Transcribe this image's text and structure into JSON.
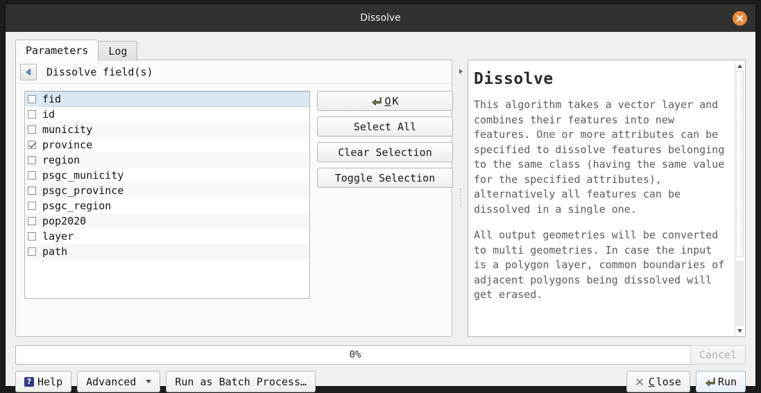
{
  "window": {
    "title": "Dissolve",
    "close_icon": "close-circle-icon"
  },
  "tabs": [
    {
      "label": "Parameters",
      "active": true
    },
    {
      "label": "Log",
      "active": false
    }
  ],
  "group": {
    "collapse_icon": "triangle-left-icon",
    "title": "Dissolve field(s)"
  },
  "field_list": {
    "items": [
      {
        "label": "fid",
        "checked": false,
        "selected": true
      },
      {
        "label": "id",
        "checked": false,
        "selected": false
      },
      {
        "label": "municity",
        "checked": false,
        "selected": false
      },
      {
        "label": "province",
        "checked": true,
        "selected": false
      },
      {
        "label": "region",
        "checked": false,
        "selected": false
      },
      {
        "label": "psgc_municity",
        "checked": false,
        "selected": false
      },
      {
        "label": "psgc_province",
        "checked": false,
        "selected": false
      },
      {
        "label": "psgc_region",
        "checked": false,
        "selected": false
      },
      {
        "label": "pop2020",
        "checked": false,
        "selected": false
      },
      {
        "label": "layer",
        "checked": false,
        "selected": false
      },
      {
        "label": "path",
        "checked": false,
        "selected": false
      }
    ]
  },
  "side_buttons": {
    "ok": {
      "label": "OK",
      "accel": "O",
      "icon": "green-enter-arrow-icon"
    },
    "select_all": "Select All",
    "clear_selection": "Clear Selection",
    "toggle_selection": "Toggle Selection"
  },
  "splitter": {
    "expand_icon": "triangle-right-icon",
    "grip_icon": "splitter-grip-icon"
  },
  "help": {
    "title": "Dissolve",
    "paragraphs": [
      "This algorithm takes a vector layer and combines their features into new features. One or more attributes can be specified to dissolve features belonging to the same class (having the same value for the specified attributes), alternatively all features can be dissolved in a single one.",
      "All output geometries will be converted to multi geometries. In case the input is a polygon layer, common boundaries of adjacent polygons being dissolved will get erased."
    ],
    "scroll_up_icon": "triangle-up-icon",
    "scroll_down_icon": "triangle-down-icon"
  },
  "progress": {
    "percent_label": "0%",
    "value": 0
  },
  "footer": {
    "cancel": {
      "label": "Cancel",
      "disabled": true
    },
    "help": {
      "label": "Help",
      "icon": "question-badge-icon"
    },
    "advanced": {
      "label": "Advanced",
      "icon": "chevron-down-icon"
    },
    "batch": {
      "label": "Run as Batch Process…"
    },
    "close": {
      "label": "Close",
      "accel": "C",
      "icon": "x-mark-icon"
    },
    "run": {
      "label": "Run",
      "icon": "green-enter-arrow-icon",
      "default": true
    }
  },
  "colors": {
    "titlebar": "#31312f",
    "close_button": "#e8883a",
    "selection": "#dbe8f2",
    "help_badge": "#2f3a86",
    "arrow_green": "#5e6b3c"
  }
}
